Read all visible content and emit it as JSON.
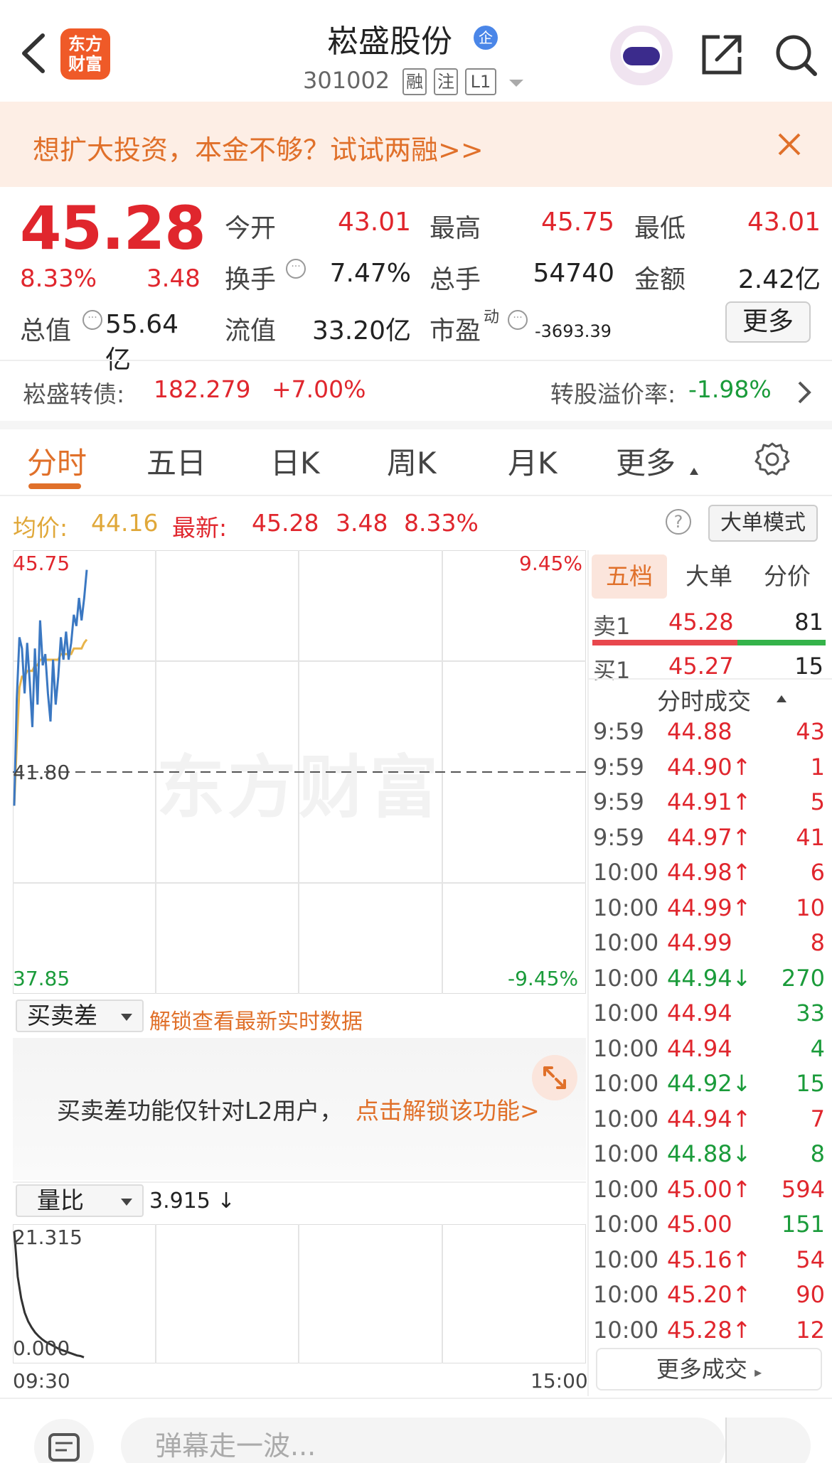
{
  "header": {
    "brand_line1": "东方",
    "brand_line2": "财富",
    "stock_name": "崧盛股份",
    "qi_badge": "企",
    "stock_code": "301002",
    "tags": [
      "融",
      "注",
      "L1"
    ]
  },
  "promo": {
    "text": "想扩大投资，本金不够？试试两融>>"
  },
  "quote": {
    "price": "45.28",
    "change_pct": "8.33%",
    "change_amt": "3.48",
    "fields": [
      {
        "label": "今开",
        "value": "43.01",
        "color": "red"
      },
      {
        "label": "最高",
        "value": "45.75",
        "color": "red"
      },
      {
        "label": "最低",
        "value": "43.01",
        "color": "red"
      },
      {
        "label": "换手",
        "value": "7.47%",
        "color": "dark"
      },
      {
        "label": "总手",
        "value": "54740",
        "color": "dark"
      },
      {
        "label": "金额",
        "value": "2.42亿",
        "color": "dark"
      },
      {
        "label": "总值",
        "value": "55.64亿",
        "color": "dark"
      },
      {
        "label": "流值",
        "value": "33.20亿",
        "color": "dark"
      },
      {
        "label": "市盈",
        "label_sup": "动",
        "value": "-3693.39",
        "color": "dark"
      }
    ],
    "more_label": "更多"
  },
  "convertible_bond": {
    "label": "崧盛转债:",
    "price": "182.279",
    "pct": "+7.00%",
    "premium_label": "转股溢价率:",
    "premium_value": "-1.98%"
  },
  "tabs": [
    "分时",
    "五日",
    "日K",
    "周K",
    "月K",
    "更多"
  ],
  "price_line": {
    "avg_label": "均价:",
    "avg_value": "44.16",
    "last_label": "最新:",
    "last_value": "45.28",
    "chg": "3.48",
    "pct": "8.33%",
    "help_icon": "?",
    "big_order_mode": "大单模式"
  },
  "chart": {
    "watermark": "东方财富",
    "y_top": "45.75",
    "y_mid": "41.80",
    "y_bottom": "37.85",
    "pct_top": "9.45%",
    "pct_bottom": "-9.45%",
    "x_start": "09:30",
    "x_end": "15:00"
  },
  "chart_data": {
    "type": "line",
    "title": "",
    "ylim": [
      37.85,
      45.75
    ],
    "x_range": [
      "09:30",
      "15:00"
    ],
    "prev_close": 41.8,
    "grid": true,
    "series": [
      {
        "name": "",
        "color": "#3b78c2",
        "values": [
          41.2,
          43.1,
          44.2,
          44.0,
          43.2,
          44.1,
          43.4,
          42.6,
          44.0,
          43.0,
          44.5,
          43.7,
          43.9,
          43.2,
          42.7,
          43.8,
          43.0,
          43.5,
          44.2,
          43.8,
          44.3,
          43.8,
          44.1,
          44.6,
          44.4,
          44.9,
          44.5,
          44.9,
          45.4
        ]
      },
      {
        "name": "",
        "color": "#e8b44a",
        "values": [
          41.2,
          42.3,
          43.3,
          43.5,
          43.5,
          43.6,
          43.6,
          43.6,
          43.7,
          43.7,
          43.8,
          43.8,
          43.8,
          43.8,
          43.8,
          43.8,
          43.8,
          43.8,
          43.9,
          43.9,
          43.9,
          43.9,
          43.9,
          44.0,
          44.0,
          44.0,
          44.0,
          44.1,
          44.16
        ]
      }
    ]
  },
  "right_panel": {
    "tabs": [
      "五档",
      "大单",
      "分价"
    ],
    "sell1": {
      "label": "卖1",
      "price": "45.28",
      "volume": "81"
    },
    "buy1": {
      "label": "买1",
      "price": "45.27",
      "volume": "15"
    },
    "trades_title": "分时成交",
    "trades": [
      {
        "time": "9:59",
        "price": "44.88",
        "vol": "43",
        "dir": "",
        "vcolor": "red"
      },
      {
        "time": "9:59",
        "price": "44.90↑",
        "vol": "1",
        "dir": "up",
        "vcolor": "red"
      },
      {
        "time": "9:59",
        "price": "44.91↑",
        "vol": "5",
        "dir": "up",
        "vcolor": "red"
      },
      {
        "time": "9:59",
        "price": "44.97↑",
        "vol": "41",
        "dir": "up",
        "vcolor": "red"
      },
      {
        "time": "10:00",
        "price": "44.98↑",
        "vol": "6",
        "dir": "up",
        "vcolor": "red"
      },
      {
        "time": "10:00",
        "price": "44.99↑",
        "vol": "10",
        "dir": "up",
        "vcolor": "red"
      },
      {
        "time": "10:00",
        "price": "44.99",
        "vol": "8",
        "dir": "",
        "vcolor": "red"
      },
      {
        "time": "10:00",
        "price": "44.94↓",
        "vol": "270",
        "dir": "down",
        "vcolor": "green"
      },
      {
        "time": "10:00",
        "price": "44.94",
        "vol": "33",
        "dir": "",
        "vcolor": "green"
      },
      {
        "time": "10:00",
        "price": "44.94",
        "vol": "4",
        "dir": "",
        "vcolor": "green"
      },
      {
        "time": "10:00",
        "price": "44.92↓",
        "vol": "15",
        "dir": "down",
        "vcolor": "green"
      },
      {
        "time": "10:00",
        "price": "44.94↑",
        "vol": "7",
        "dir": "up",
        "vcolor": "red"
      },
      {
        "time": "10:00",
        "price": "44.88↓",
        "vol": "8",
        "dir": "down",
        "vcolor": "green"
      },
      {
        "time": "10:00",
        "price": "45.00↑",
        "vol": "594",
        "dir": "up",
        "vcolor": "red"
      },
      {
        "time": "10:00",
        "price": "45.00",
        "vol": "151",
        "dir": "",
        "vcolor": "green"
      },
      {
        "time": "10:00",
        "price": "45.16↑",
        "vol": "54",
        "dir": "up",
        "vcolor": "red"
      },
      {
        "time": "10:00",
        "price": "45.20↑",
        "vol": "90",
        "dir": "up",
        "vcolor": "red"
      },
      {
        "time": "10:00",
        "price": "45.28↑",
        "vol": "12",
        "dir": "up",
        "vcolor": "red"
      }
    ],
    "more_trades": "更多成交"
  },
  "indicators": {
    "mmc_dropdown": "买卖差",
    "unlock_link": "解锁查看最新实时数据",
    "l2_text": "买卖差功能仅针对L2用户，",
    "l2_link": "点击解锁该功能>",
    "lb_dropdown": "量比",
    "lb_value": "3.915 ↓",
    "lb_top": "21.315",
    "lb_bottom": "0.000",
    "lb_series": [
      21.3,
      14.0,
      10.5,
      8.2,
      6.8,
      5.8,
      5.0,
      4.4,
      3.9,
      3.5,
      3.2,
      2.9,
      2.6,
      2.3,
      2.1,
      1.9,
      1.7,
      1.5,
      1.3,
      1.2,
      1.0
    ]
  },
  "bottombar": {
    "danmu_placeholder": "弹幕走一波..."
  },
  "colors": {
    "up": "#e0262d",
    "down": "#1a9b3a",
    "accent": "#e0702a",
    "price_line": "#3b78c2",
    "avg_line": "#e8b44a"
  }
}
